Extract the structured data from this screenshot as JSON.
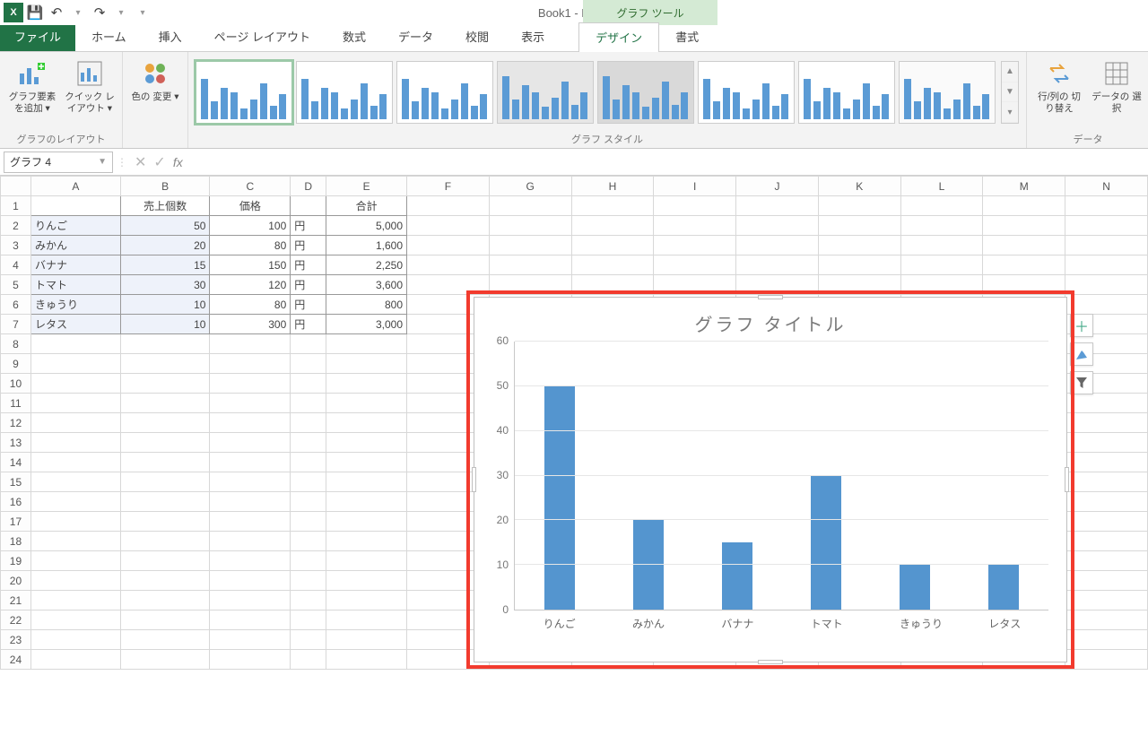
{
  "qat": {
    "excel_glyph": "X",
    "save": "💾",
    "undo": "↶",
    "redo": "↷",
    "customize": "▾"
  },
  "window_title": "Book1 - Excel",
  "context_tab_header": "グラフ ツール",
  "tabs": {
    "file": "ファイル",
    "home": "ホーム",
    "insert": "挿入",
    "pagelayout": "ページ レイアウト",
    "formulas": "数式",
    "data": "データ",
    "review": "校閲",
    "view": "表示",
    "design": "デザイン",
    "format": "書式"
  },
  "ribbon": {
    "layout_group": "グラフのレイアウト",
    "add_element": "グラフ要素\nを追加 ▾",
    "quick_layout": "クイック\nレイアウト ▾",
    "change_colors": "色の\n変更 ▾",
    "styles_group": "グラフ スタイル",
    "switch_rc": "行/列の\n切り替え",
    "select_data": "データの\n選択",
    "data_group": "データ"
  },
  "namebox": "グラフ 4",
  "columns": [
    "A",
    "B",
    "C",
    "D",
    "E",
    "F",
    "G",
    "H",
    "I",
    "J",
    "K",
    "L",
    "M",
    "N"
  ],
  "rows": 24,
  "table": {
    "head": {
      "b": "売上個数",
      "c": "価格",
      "e": "合計"
    },
    "rows": [
      {
        "a": "りんご",
        "b": "50",
        "c": "100",
        "d": "円",
        "e": "5,000"
      },
      {
        "a": "みかん",
        "b": "20",
        "c": "80",
        "d": "円",
        "e": "1,600"
      },
      {
        "a": "バナナ",
        "b": "15",
        "c": "150",
        "d": "円",
        "e": "2,250"
      },
      {
        "a": "トマト",
        "b": "30",
        "c": "120",
        "d": "円",
        "e": "3,600"
      },
      {
        "a": "きゅうり",
        "b": "10",
        "c": "80",
        "d": "円",
        "e": "800"
      },
      {
        "a": "レタス",
        "b": "10",
        "c": "300",
        "d": "円",
        "e": "3,000"
      }
    ]
  },
  "chart_data": {
    "type": "bar",
    "title": "グラフ タイトル",
    "categories": [
      "りんご",
      "みかん",
      "バナナ",
      "トマト",
      "きゅうり",
      "レタス"
    ],
    "values": [
      50,
      20,
      15,
      30,
      10,
      10
    ],
    "ylim": [
      0,
      60
    ],
    "yticks": [
      0,
      10,
      20,
      30,
      40,
      50,
      60
    ],
    "xlabel": "",
    "ylabel": ""
  }
}
